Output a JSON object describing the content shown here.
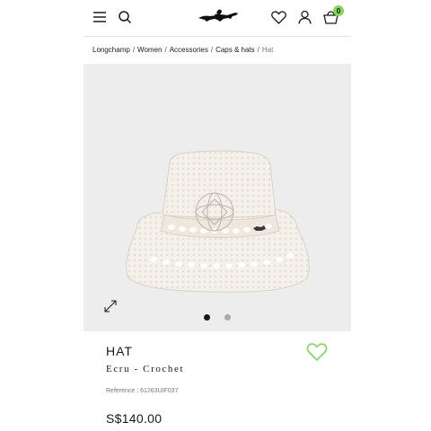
{
  "header": {
    "menu_icon": "hamburger-menu-icon",
    "search_icon": "search-icon",
    "logo_icon": "longchamp-horse-logo",
    "wishlist_icon": "heart-icon",
    "account_icon": "user-icon",
    "cart_icon": "shopping-basket-icon",
    "cart_count": "0"
  },
  "breadcrumb": {
    "items": [
      "Longchamp",
      "Women",
      "Accessories",
      "Caps & hats",
      "Hat"
    ],
    "separator": "/"
  },
  "gallery": {
    "expand_icon": "expand-arrows-icon",
    "slide_count": 2,
    "active_slide": 1
  },
  "product": {
    "name": "HAT",
    "variant": "Ecru - Crochet",
    "reference": "Reference : 61263UIF037",
    "price": "S$140.00",
    "favorite_icon": "heart-outline-icon"
  },
  "colors": {
    "accent_green": "#7ed957",
    "image_background": "#eeeded",
    "text": "#1a1a1a"
  }
}
